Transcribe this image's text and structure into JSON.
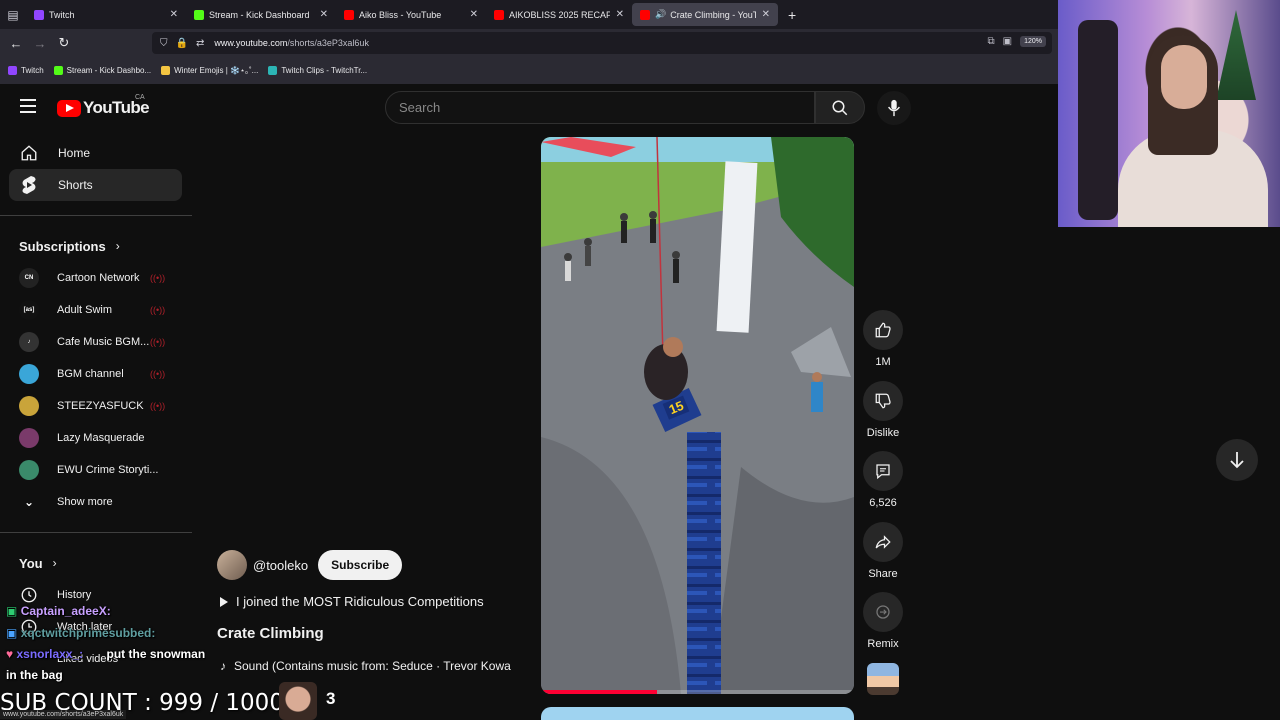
{
  "browser": {
    "tabs": [
      {
        "title": "Twitch",
        "color": "#9146ff"
      },
      {
        "title": "Stream - Kick Dashboard",
        "color": "#53fc18"
      },
      {
        "title": "Aiko Bliss - YouTube",
        "color": "#ff0000"
      },
      {
        "title": "AIKOBLISS 2025 RECAP - YouTu",
        "color": "#ff0000"
      },
      {
        "title": "Crate Climbing - YouTube",
        "color": "#ff0000"
      }
    ],
    "url_domain": "www.youtube.com",
    "url_path": "/shorts/a3eP3xal6uk",
    "zoom": "120%",
    "bookmarks": [
      "Twitch",
      "Stream - Kick Dashbo...",
      "Winter Emojis | ❄️⋆｡˚...",
      "Twitch Clips - TwitchTr..."
    ]
  },
  "youtube": {
    "logo_text": "YouTube",
    "country_code": "CA",
    "search_placeholder": "Search",
    "nav": {
      "home": "Home",
      "shorts": "Shorts"
    },
    "subscriptions_heading": "Subscriptions",
    "subscriptions": [
      {
        "name": "Cartoon Network",
        "badge": "CN",
        "color": "#222222",
        "live": true
      },
      {
        "name": "Adult Swim",
        "badge": "[as]",
        "color": "#111111",
        "live": true
      },
      {
        "name": "Cafe Music BGM...",
        "badge": "♪",
        "color": "#333333",
        "live": true
      },
      {
        "name": "BGM channel",
        "badge": "",
        "color": "#3aa6d8",
        "live": true
      },
      {
        "name": "STEEZYASFUCK",
        "badge": "",
        "color": "#c9a43a",
        "live": true
      },
      {
        "name": "Lazy Masquerade",
        "badge": "",
        "color": "#7a3a6a",
        "live": false
      },
      {
        "name": "EWU Crime Storyti...",
        "badge": "",
        "color": "#3a8a6a",
        "live": false
      }
    ],
    "show_more": "Show more",
    "you_heading": "You",
    "history": "History",
    "watch_later": "Watch later",
    "liked_videos": "Liked videos",
    "short": {
      "crate_number": "15",
      "progress": 0.37,
      "channel_handle": "@tooleko",
      "subscribe_label": "Subscribe",
      "playlist_title": "I joined the MOST Ridiculous Competitions",
      "title": "Crate Climbing",
      "sound": "Sound (Contains music from: Seduce · Trevor Kowa"
    },
    "actions": {
      "likes": "1M",
      "dislike": "Dislike",
      "comments": "6,526",
      "share": "Share",
      "remix": "Remix"
    }
  },
  "stream_overlay": {
    "chat": [
      {
        "user": "Captain_adeeX:",
        "message": "",
        "color": "#c8a0ff"
      },
      {
        "user": "xqctwitchprimesubbed:",
        "message": "",
        "color": "#5f9ea0"
      },
      {
        "user": "xsnorlaxx_:",
        "message": "put the snowman",
        "color": "#7b6cff"
      },
      {
        "user": "",
        "message": "in the bag",
        "color": "#ffffff"
      }
    ],
    "status_url": "www.youtube.com/shorts/a3eP3xal6uk",
    "sub_count": "SUB COUNT : 999 / 1000",
    "sub_badge_number": "3"
  }
}
